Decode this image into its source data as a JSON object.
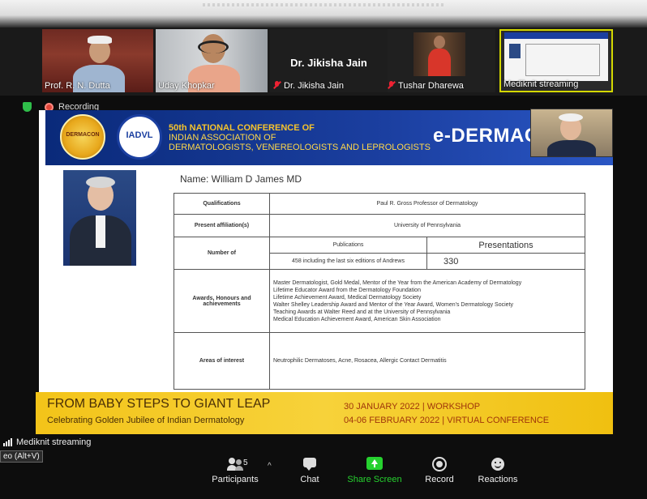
{
  "participants": [
    {
      "name": "Prof. R. N. Dutta",
      "muted": false
    },
    {
      "name": "Uday Khopkar",
      "muted": false
    },
    {
      "name": "Dr. Jikisha Jain",
      "display_name": "Dr. Jikisha Jain",
      "muted": true
    },
    {
      "name": "Tushar Dharewa",
      "muted": true
    },
    {
      "name": "Mediknit streaming",
      "muted": false
    }
  ],
  "recording": {
    "label": "Recording"
  },
  "slide": {
    "conference": {
      "line1": "50th NATIONAL CONFERENCE OF",
      "line2": "INDIAN ASSOCIATION OF",
      "line3": "DERMATOLOGISTS, VENEREOLOGISTS AND LEPROLOGISTS",
      "brand": "e-DERMACO",
      "logo2_text": "IADVL"
    },
    "name_line": "Name: William D James MD",
    "table": {
      "qualification_label": "Qualifications",
      "qualification_value": "Paul R. Gross Professor of Dermatology",
      "affiliation_label": "Present affiliation(s)",
      "affiliation_value": "University of Pennsylvania",
      "number_label": "Number of",
      "publications_header": "Publications",
      "presentations_header": "Presentations",
      "publications_value": "458 including the last six editions of Andrews",
      "presentations_value": "330",
      "awards_label": "Awards, Honours and achievements",
      "awards": [
        "Master Dermatologist, Gold Medal, Mentor of the Year from the American Academy of Dermatology",
        "Lifetime Educator Award from the Dermatology Foundation",
        "Lifetime Achievement Award, Medical Dermatology Society",
        "Walter Shelley Leadership Award and Mentor of the Year Award, Women's Dermatology Society",
        "Teaching Awards at Walter Reed and at the University of Pennsylvania",
        "Medical Education Achievement Award, American Skin Association"
      ],
      "interest_label": "Areas of interest",
      "interest_value": "Neutrophilic Dermatoses, Acne, Rosacea, Allergic Contact Dermatitis"
    },
    "footer": {
      "headline": "FROM BABY STEPS TO GIANT LEAP",
      "subline": "Celebrating Golden Jubilee of Indian Dermatology",
      "date1": "30 JANUARY 2022 | WORKSHOP",
      "date2": "04-06 FEBRUARY 2022 | VIRTUAL CONFERENCE"
    }
  },
  "stream_label": "Mediknit streaming",
  "shortcut": "eo (Alt+V)",
  "toolbar": {
    "participants_count": "5",
    "participants": "Participants",
    "chat": "Chat",
    "share": "Share Screen",
    "record": "Record",
    "reactions": "Reactions"
  },
  "colors": {
    "banner": "#1b3fa0",
    "footer": "#f3c419",
    "share_green": "#26d12f",
    "active_border": "#d4d800",
    "muted_red": "#e23"
  }
}
